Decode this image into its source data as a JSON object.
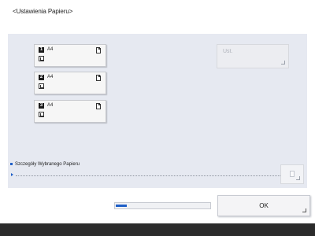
{
  "title": "<Ustawienia Papieru>",
  "drawers": [
    {
      "number": "1",
      "paper_size": "A4",
      "orientation_icon": "portrait-paper-icon",
      "tray_icon": "paper-tray-icon"
    },
    {
      "number": "2",
      "paper_size": "A4",
      "orientation_icon": "portrait-paper-icon",
      "tray_icon": "paper-tray-icon"
    },
    {
      "number": "3",
      "paper_size": "A4",
      "orientation_icon": "portrait-paper-icon",
      "tray_icon": "paper-tray-icon"
    }
  ],
  "settings_button": {
    "label": "Ust.",
    "enabled": false
  },
  "details": {
    "label": "Szczegóły Wybranego Papieru"
  },
  "progress": {
    "fraction": 0.12
  },
  "ok_button": {
    "label": "OK"
  },
  "colors": {
    "accent": "#1f5fc7",
    "panel": "#e6e9f1",
    "bottom_bar": "#2b2b2b"
  }
}
